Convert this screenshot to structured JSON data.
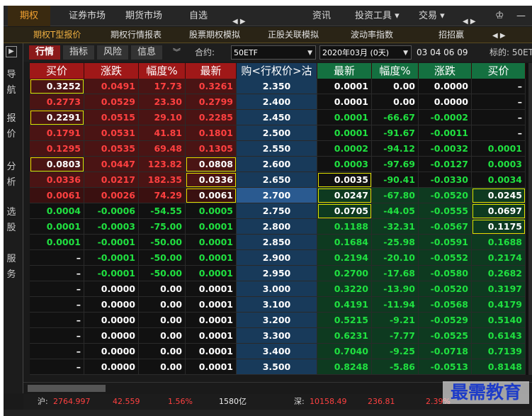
{
  "menu": {
    "items": [
      "期权",
      "证券市场",
      "期货市场",
      "自选",
      "资讯",
      "投资工具 ▾",
      "交易 ▾"
    ]
  },
  "subtabs": [
    "期权T型报价",
    "期权行情报表",
    "股票期权模拟",
    "正股关联模拟",
    "波动率指数",
    "招招赢"
  ],
  "leftnav": [
    "导航",
    "报价",
    "分析",
    "选股",
    "服务"
  ],
  "toolbar": {
    "tabs": [
      "行情",
      "指标",
      "风险",
      "信息"
    ],
    "contract_label": "合约:",
    "contract_value": "50ETF",
    "month_value": "2020年03月 (0天)",
    "months": "03  04  06  09",
    "underlying_label": "标的: 50ET"
  },
  "headers": {
    "call": [
      "买价",
      "涨跌",
      "幅度%",
      "最新"
    ],
    "strike": "购<行权价>沽 ↑",
    "put": [
      "最新",
      "幅度%",
      "涨跌",
      "买价"
    ]
  },
  "rows": [
    {
      "cb": "0.3252",
      "cc": "0.0491",
      "cp": "17.73",
      "cl": "0.3261",
      "k": "2.350",
      "pl": "0.0001",
      "pp": "0.00",
      "pc": "0.0000",
      "pb": "–",
      "bx": [
        "cb"
      ]
    },
    {
      "cb": "0.2773",
      "cc": "0.0529",
      "cp": "23.30",
      "cl": "0.2799",
      "k": "2.400",
      "pl": "0.0001",
      "pp": "0.00",
      "pc": "0.0000",
      "pb": "–",
      "bx": []
    },
    {
      "cb": "0.2291",
      "cc": "0.0515",
      "cp": "29.10",
      "cl": "0.2285",
      "k": "2.450",
      "pl": "0.0001",
      "pp": "-66.67",
      "pc": "-0.0002",
      "pb": "–",
      "bx": [
        "cb"
      ]
    },
    {
      "cb": "0.1791",
      "cc": "0.0531",
      "cp": "41.81",
      "cl": "0.1801",
      "k": "2.500",
      "pl": "0.0001",
      "pp": "-91.67",
      "pc": "-0.0011",
      "pb": "–",
      "bx": []
    },
    {
      "cb": "0.1295",
      "cc": "0.0535",
      "cp": "69.48",
      "cl": "0.1305",
      "k": "2.550",
      "pl": "0.0002",
      "pp": "-94.12",
      "pc": "-0.0032",
      "pb": "0.0001",
      "bx": []
    },
    {
      "cb": "0.0803",
      "cc": "0.0447",
      "cp": "123.82",
      "cl": "0.0808",
      "k": "2.600",
      "pl": "0.0003",
      "pp": "-97.69",
      "pc": "-0.0127",
      "pb": "0.0003",
      "bx": [
        "cb",
        "cl"
      ]
    },
    {
      "cb": "0.0336",
      "cc": "0.0217",
      "cp": "182.35",
      "cl": "0.0336",
      "k": "2.650",
      "pl": "0.0035",
      "pp": "-90.41",
      "pc": "-0.0330",
      "pb": "0.0034",
      "bx": [
        "cl",
        "pl"
      ]
    },
    {
      "cb": "0.0061",
      "cc": "0.0026",
      "cp": "74.29",
      "cl": "0.0061",
      "k": "2.700",
      "pl": "0.0247",
      "pp": "-67.80",
      "pc": "-0.0520",
      "pb": "0.0245",
      "bx": [
        "cl",
        "pl",
        "pb"
      ]
    },
    {
      "cb": "0.0004",
      "cc": "-0.0006",
      "cp": "-54.55",
      "cl": "0.0005",
      "k": "2.750",
      "pl": "0.0705",
      "pp": "-44.05",
      "pc": "-0.0555",
      "pb": "0.0697",
      "bx": [
        "pl",
        "pb"
      ]
    },
    {
      "cb": "0.0001",
      "cc": "-0.0003",
      "cp": "-75.00",
      "cl": "0.0001",
      "k": "2.800",
      "pl": "0.1188",
      "pp": "-32.31",
      "pc": "-0.0567",
      "pb": "0.1175",
      "bx": [
        "pb"
      ]
    },
    {
      "cb": "0.0001",
      "cc": "-0.0001",
      "cp": "-50.00",
      "cl": "0.0001",
      "k": "2.850",
      "pl": "0.1684",
      "pp": "-25.98",
      "pc": "-0.0591",
      "pb": "0.1688",
      "bx": []
    },
    {
      "cb": "–",
      "cc": "-0.0001",
      "cp": "-50.00",
      "cl": "0.0001",
      "k": "2.900",
      "pl": "0.2194",
      "pp": "-20.10",
      "pc": "-0.0552",
      "pb": "0.2174",
      "bx": []
    },
    {
      "cb": "–",
      "cc": "-0.0001",
      "cp": "-50.00",
      "cl": "0.0001",
      "k": "2.950",
      "pl": "0.2700",
      "pp": "-17.68",
      "pc": "-0.0580",
      "pb": "0.2682",
      "bx": []
    },
    {
      "cb": "–",
      "cc": "0.0000",
      "cp": "0.00",
      "cl": "0.0001",
      "k": "3.000",
      "pl": "0.3220",
      "pp": "-13.90",
      "pc": "-0.0520",
      "pb": "0.3197",
      "bx": []
    },
    {
      "cb": "–",
      "cc": "0.0000",
      "cp": "0.00",
      "cl": "0.0001",
      "k": "3.100",
      "pl": "0.4191",
      "pp": "-11.94",
      "pc": "-0.0568",
      "pb": "0.4179",
      "bx": []
    },
    {
      "cb": "–",
      "cc": "0.0000",
      "cp": "0.00",
      "cl": "0.0001",
      "k": "3.200",
      "pl": "0.5215",
      "pp": "-9.21",
      "pc": "-0.0529",
      "pb": "0.5140",
      "bx": []
    },
    {
      "cb": "–",
      "cc": "0.0000",
      "cp": "0.00",
      "cl": "0.0001",
      "k": "3.300",
      "pl": "0.6231",
      "pp": "-7.77",
      "pc": "-0.0525",
      "pb": "0.6143",
      "bx": []
    },
    {
      "cb": "–",
      "cc": "0.0000",
      "cp": "0.00",
      "cl": "0.0001",
      "k": "3.400",
      "pl": "0.7040",
      "pp": "-9.25",
      "pc": "-0.0718",
      "pb": "0.7139",
      "bx": []
    },
    {
      "cb": "–",
      "cc": "0.0000",
      "cp": "0.00",
      "cl": "0.0001",
      "k": "3.500",
      "pl": "0.8248",
      "pp": "-5.86",
      "pc": "-0.0513",
      "pb": "0.8148",
      "bx": []
    }
  ],
  "status": {
    "sh_label": "沪:",
    "sh_index": "2764.997",
    "sh_change": "42.559",
    "sh_pct": "1.56%",
    "sh_vol": "1580亿",
    "sz_label": "深:",
    "sz_index": "10158.49",
    "sz_change": "236.81",
    "sz_pct": "2.39%"
  },
  "watermark": "最需教育",
  "colors": {
    "up": "#ff4040",
    "down": "#20e040",
    "call_hdr": "#a01818",
    "put_hdr": "#147040",
    "strike_bg": "#183a5a",
    "strike_atm": "#2a5a90",
    "itm_call": "#4a1414",
    "itm_put": "#0e3a20",
    "otm": "#111"
  }
}
